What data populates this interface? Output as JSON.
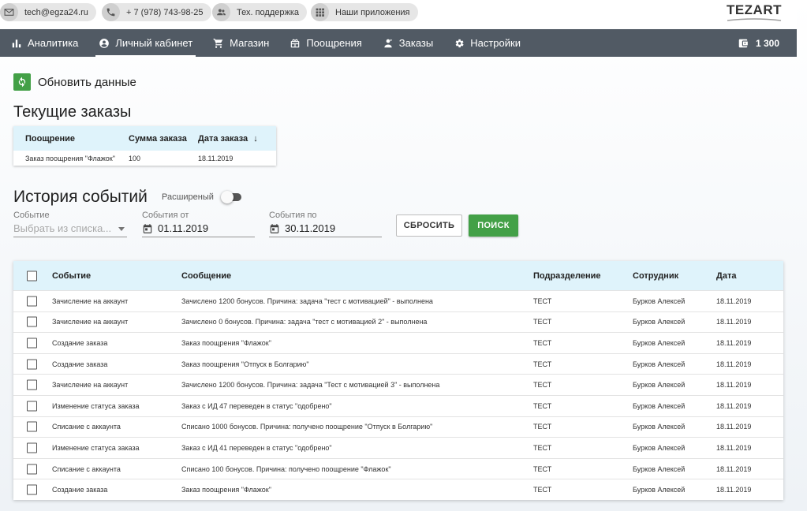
{
  "topbar": {
    "email": "tech@egza24.ru",
    "phone": "+ 7 (978) 743-98-25",
    "support": "Тех. поддержка",
    "apps": "Наши приложения",
    "brand": "TEZART"
  },
  "nav": {
    "items": [
      {
        "label": "Аналитика",
        "icon": "bar-chart-icon"
      },
      {
        "label": "Личный кабинет",
        "icon": "account-circle-icon",
        "active": true
      },
      {
        "label": "Магазин",
        "icon": "cart-icon"
      },
      {
        "label": "Поощрения",
        "icon": "gift-icon"
      },
      {
        "label": "Заказы",
        "icon": "user-orders-icon"
      },
      {
        "label": "Настройки",
        "icon": "gear-icon"
      }
    ],
    "balance": "1 300"
  },
  "refresh_label": "Обновить данные",
  "current_orders": {
    "title": "Текущие заказы",
    "columns": [
      "Поощрение",
      "Сумма заказа",
      "Дата заказа"
    ],
    "sort_arrow": "↓",
    "rows": [
      [
        "Заказ поощрения \"Флажок\"",
        "100",
        "18.11.2019"
      ]
    ]
  },
  "history": {
    "title": "История событий",
    "toggle_label": "Расширеный",
    "filters": {
      "event_label": "Событие",
      "event_placeholder": "Выбрать из списка...",
      "from_label": "События от",
      "from_value": "01.11.2019",
      "to_label": "События по",
      "to_value": "30.11.2019"
    },
    "reset_label": "СБРОСИТЬ",
    "search_label": "ПОИСК",
    "columns": [
      "Событие",
      "Сообщение",
      "Подразделение",
      "Сотрудник",
      "Дата"
    ],
    "rows": [
      [
        "Зачисление на аккаунт",
        "Зачислено 1200 бонусов. Причина: задача \"тест с мотивацией\" - выполнена",
        "ТЕСТ",
        "Бурков Алексей",
        "18.11.2019"
      ],
      [
        "Зачисление на аккаунт",
        "Зачислено 0 бонусов. Причина: задача \"тест с мотивацией 2\" - выполнена",
        "ТЕСТ",
        "Бурков Алексей",
        "18.11.2019"
      ],
      [
        "Создание заказа",
        "Заказ поощрения \"Флажок\"",
        "ТЕСТ",
        "Бурков Алексей",
        "18.11.2019"
      ],
      [
        "Создание заказа",
        "Заказ поощрения \"Отпуск в Болгарию\"",
        "ТЕСТ",
        "Бурков Алексей",
        "18.11.2019"
      ],
      [
        "Зачисление на аккаунт",
        "Зачислено 1200 бонусов. Причина: задача \"Тест с мотивацией 3\" - выполнена",
        "ТЕСТ",
        "Бурков Алексей",
        "18.11.2019"
      ],
      [
        "Изменение статуса заказа",
        "Заказ с ИД 47 переведен в статус \"одобрено\"",
        "ТЕСТ",
        "Бурков Алексей",
        "18.11.2019"
      ],
      [
        "Списание с аккаунта",
        "Списано 1000 бонусов. Причина: получено поощрение \"Отпуск в Болгарию\"",
        "ТЕСТ",
        "Бурков Алексей",
        "18.11.2019"
      ],
      [
        "Изменение статуса заказа",
        "Заказ с ИД 41 переведен в статус \"одобрено\"",
        "ТЕСТ",
        "Бурков Алексей",
        "18.11.2019"
      ],
      [
        "Списание с аккаунта",
        "Списано 100 бонусов. Причина: получено поощрение \"Флажок\"",
        "ТЕСТ",
        "Бурков Алексей",
        "18.11.2019"
      ],
      [
        "Создание заказа",
        "Заказ поощрения \"Флажок\"",
        "ТЕСТ",
        "Бурков Алексей",
        "18.11.2019"
      ]
    ]
  },
  "colors": {
    "nav_bg": "#515a64",
    "accent_green": "#43a047",
    "table_header_bg": "#dff3fb"
  }
}
